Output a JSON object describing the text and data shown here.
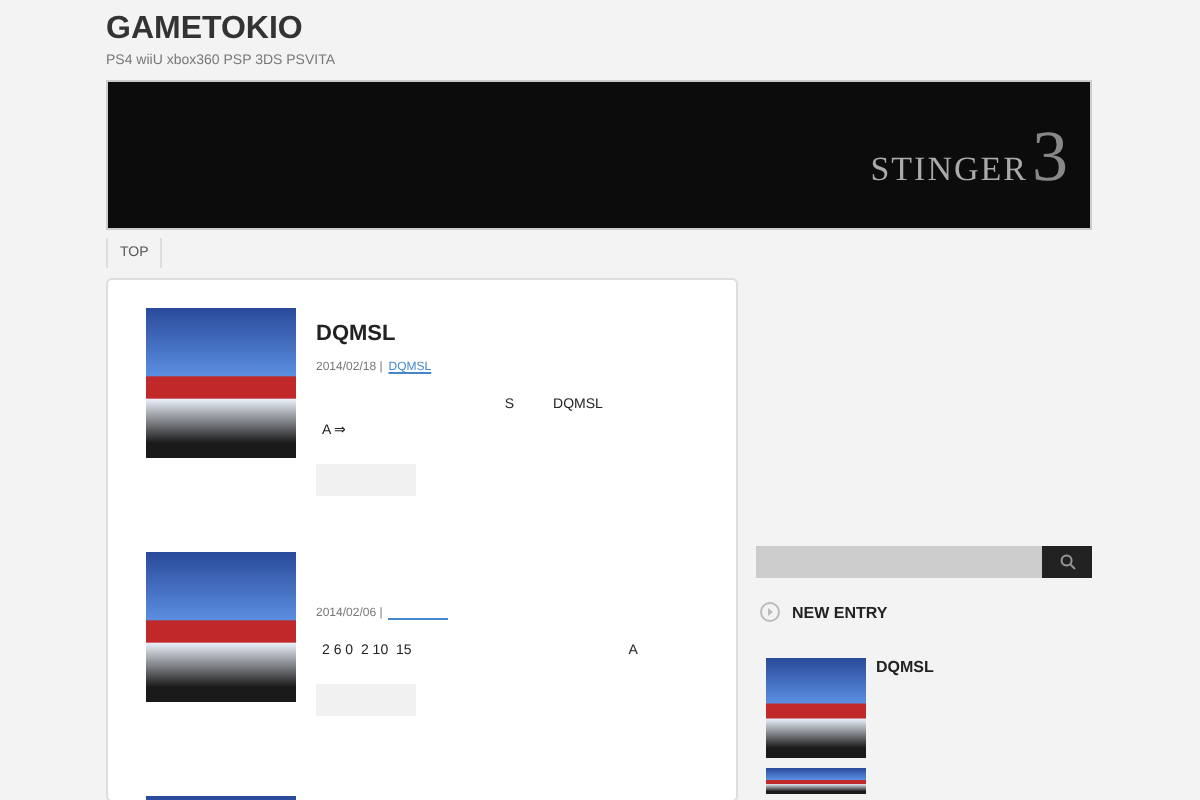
{
  "site": {
    "title": "GAMETOKIO",
    "tagline": "PS4 wiiU xbox360 PSP 3DS PSVITA"
  },
  "banner": {
    "logo_word": "STINGER",
    "logo_number": "3"
  },
  "nav": [
    {
      "label": "TOP"
    }
  ],
  "posts": [
    {
      "kind": "full",
      "title": "DQMSL",
      "date": "2014/02/18 |",
      "category": "DQMSL",
      "excerpt": [
        "                                               S          DQMSL",
        "A ⇒"
      ]
    },
    {
      "kind": "full",
      "date": "2014/02/06 |",
      "excerpt": [
        "2 6 0  2 10  15                                                        A"
      ]
    },
    {
      "kind": "cut_off"
    }
  ],
  "sidebar": {
    "heading": "NEW ENTRY",
    "entries": [
      {
        "kind": "full",
        "title": "DQMSL"
      },
      {
        "kind": "cut_off"
      }
    ]
  }
}
